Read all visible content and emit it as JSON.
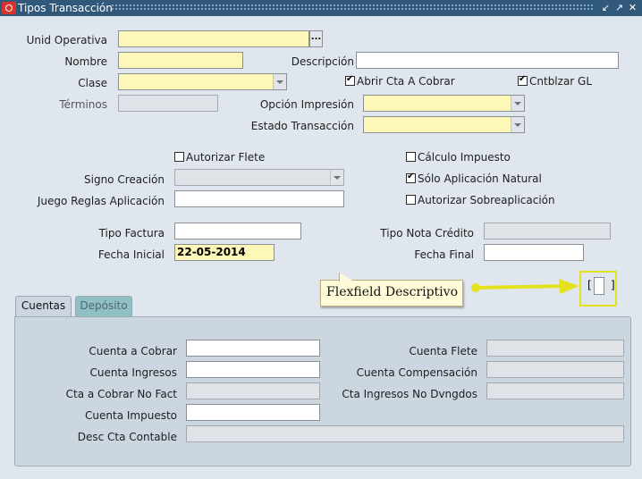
{
  "window": {
    "title": "Tipos Transacción",
    "controls": [
      "minimize-restore",
      "maximize",
      "close"
    ]
  },
  "header": {
    "unid_operativa": {
      "label": "Unid Operativa",
      "value": "",
      "lov_button": "..."
    },
    "nombre": {
      "label": "Nombre",
      "value": ""
    },
    "descripcion": {
      "label": "Descripción",
      "value": ""
    },
    "clase": {
      "label": "Clase",
      "value": ""
    },
    "terminos": {
      "label": "Términos",
      "value": ""
    },
    "opcion_impresion": {
      "label": "Opción Impresión",
      "value": ""
    },
    "estado_transaccion": {
      "label": "Estado Transacción",
      "value": ""
    },
    "abrir_cta_cobrar": {
      "label": "Abrir Cta A Cobrar",
      "checked": true
    },
    "cntblzar_gl": {
      "label": "Cntblzar GL",
      "checked": true
    }
  },
  "options": {
    "autorizar_flete": {
      "label": "Autorizar Flete",
      "checked": false
    },
    "calculo_impuesto": {
      "label": "Cálculo Impuesto",
      "checked": false
    },
    "signo_creacion": {
      "label": "Signo Creación",
      "value": ""
    },
    "solo_aplicacion_natural": {
      "label": "Sólo Aplicación Natural",
      "checked": true
    },
    "juego_reglas_aplicacion": {
      "label": "Juego Reglas Aplicación",
      "value": ""
    },
    "autorizar_sobreaplicacion": {
      "label": "Autorizar Sobreaplicación",
      "checked": false
    },
    "tipo_factura": {
      "label": "Tipo Factura",
      "value": ""
    },
    "tipo_nota_credito": {
      "label": "Tipo Nota Crédito",
      "value": ""
    },
    "fecha_inicial": {
      "label": "Fecha Inicial",
      "value": "22-05-2014"
    },
    "fecha_final": {
      "label": "Fecha Final",
      "value": ""
    }
  },
  "flexfield": {
    "callout_text": "Flexfield Descriptivo",
    "bracket_open": "[",
    "bracket_close": "]",
    "highlight_color": "#e4e21f"
  },
  "tabs": [
    {
      "label": "Cuentas",
      "active": true
    },
    {
      "label": "Depósito",
      "active": false
    }
  ],
  "cuentas": {
    "cuenta_a_cobrar": {
      "label": "Cuenta a Cobrar",
      "value": ""
    },
    "cuenta_flete": {
      "label": "Cuenta Flete",
      "value": ""
    },
    "cuenta_ingresos": {
      "label": "Cuenta Ingresos",
      "value": ""
    },
    "cuenta_compensacion": {
      "label": "Cuenta Compensación",
      "value": ""
    },
    "cta_cobrar_no_fact": {
      "label": "Cta a Cobrar No Fact",
      "value": ""
    },
    "cta_ingresos_no_dvngdos": {
      "label": "Cta Ingresos No Dvngdos",
      "value": ""
    },
    "cuenta_impuesto": {
      "label": "Cuenta Impuesto",
      "value": ""
    },
    "desc_cta_contable": {
      "label": "Desc Cta Contable",
      "value": ""
    }
  },
  "colors": {
    "title_bar": "#30587b",
    "required_field": "#fdf8b7",
    "readonly_field": "#dfe3e8",
    "window_bg": "#dfe6ee",
    "tab_inactive": "#8fc0c3"
  }
}
